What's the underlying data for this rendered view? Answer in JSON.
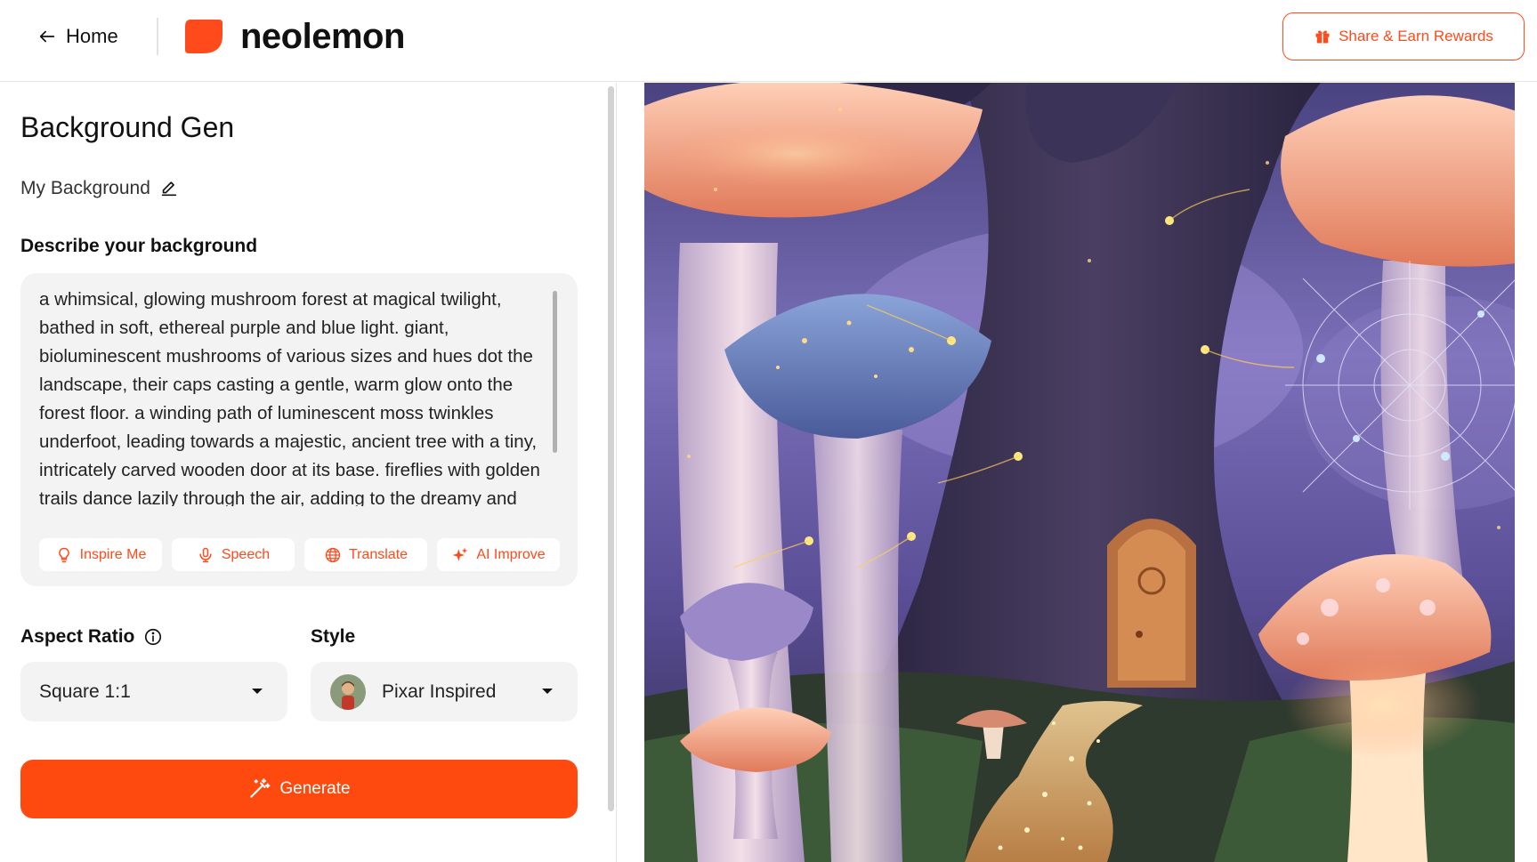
{
  "header": {
    "home_label": "Home",
    "brand": "neolemon",
    "share_label": "Share & Earn Rewards"
  },
  "panel": {
    "title": "Background Gen",
    "background_name": "My Background",
    "describe_label": "Describe your background",
    "prompt": "a whimsical, glowing mushroom forest at magical twilight, bathed in soft, ethereal purple and blue light. giant, bioluminescent mushrooms of various sizes and hues dot the landscape, their caps casting a gentle, warm glow onto the forest floor. a winding path of luminescent moss twinkles underfoot, leading towards a majestic, ancient tree with a tiny, intricately carved wooden door at its base. fireflies with golden trails dance lazily through the air, adding to the dreamy and",
    "chips": [
      {
        "label": "Inspire Me",
        "icon": "lightbulb-icon"
      },
      {
        "label": "Speech",
        "icon": "microphone-icon"
      },
      {
        "label": "Translate",
        "icon": "globe-icon"
      },
      {
        "label": "AI Improve",
        "icon": "sparkle-icon"
      }
    ],
    "aspect_label": "Aspect Ratio",
    "aspect_value": "Square 1:1",
    "style_label": "Style",
    "style_value": "Pixar Inspired",
    "generate_label": "Generate"
  },
  "colors": {
    "accent": "#ff4a0f",
    "field_bg": "#f3f3f3"
  }
}
